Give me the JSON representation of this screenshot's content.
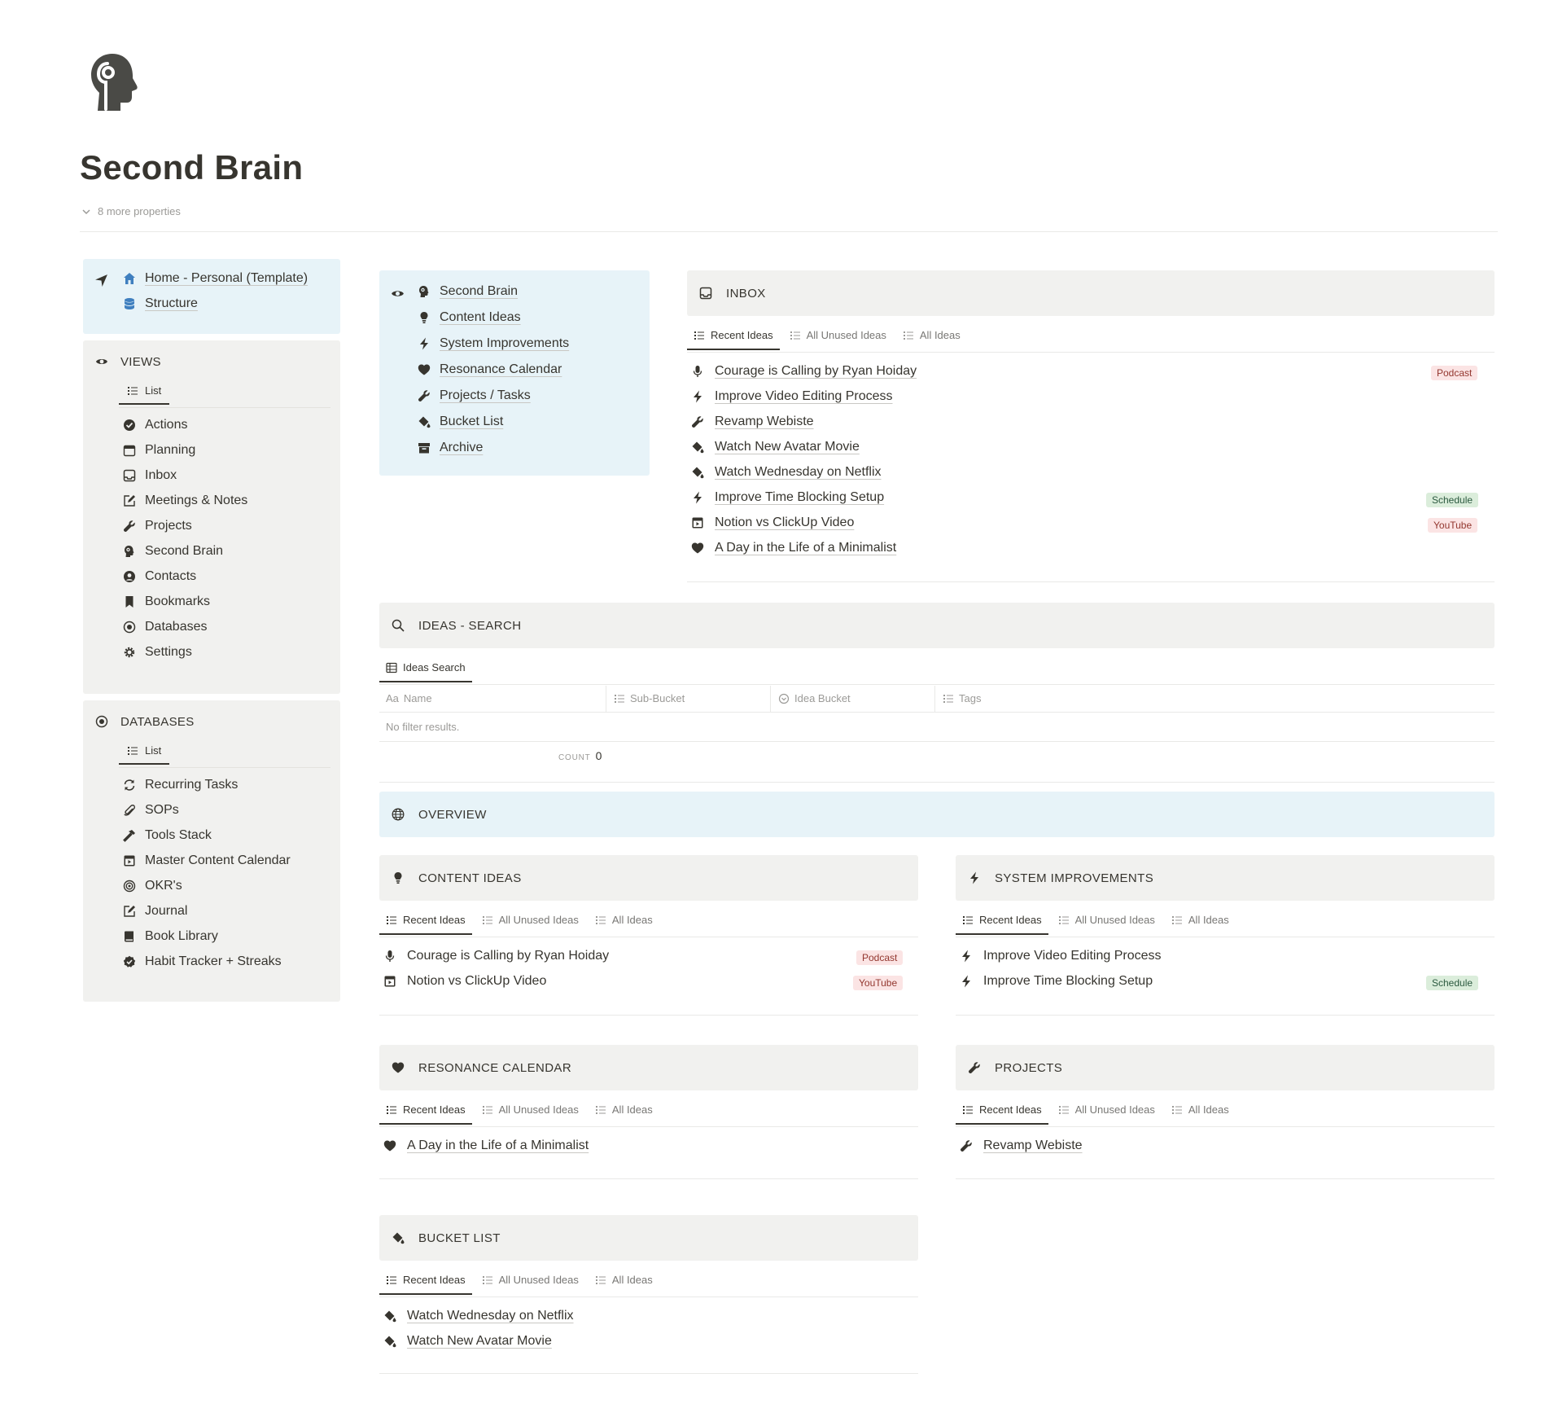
{
  "page": {
    "title": "Second Brain",
    "more_properties": "8 more properties"
  },
  "nav_panel": {
    "items": [
      {
        "label": "Home - Personal (Template)",
        "icon": "house-icon"
      },
      {
        "label": "Structure",
        "icon": "database-stack-icon"
      }
    ]
  },
  "views_panel": {
    "heading": "VIEWS",
    "tab": "List",
    "items": [
      {
        "label": "Actions",
        "icon": "check-circle-icon"
      },
      {
        "label": "Planning",
        "icon": "calendar-icon"
      },
      {
        "label": "Inbox",
        "icon": "inbox-icon"
      },
      {
        "label": "Meetings & Notes",
        "icon": "edit-note-icon"
      },
      {
        "label": "Projects",
        "icon": "wrench-icon"
      },
      {
        "label": "Second Brain",
        "icon": "brain-head-icon"
      },
      {
        "label": "Contacts",
        "icon": "user-circle-icon"
      },
      {
        "label": "Bookmarks",
        "icon": "bookmark-icon"
      },
      {
        "label": "Databases",
        "icon": "target-icon"
      },
      {
        "label": "Settings",
        "icon": "gear-icon"
      }
    ]
  },
  "databases_panel": {
    "heading": "DATABASES",
    "tab": "List",
    "items": [
      {
        "label": "Recurring Tasks",
        "icon": "refresh-icon"
      },
      {
        "label": "SOPs",
        "icon": "paperclip-icon"
      },
      {
        "label": "Tools Stack",
        "icon": "hammer-icon"
      },
      {
        "label": "Master Content Calendar",
        "icon": "film-calendar-icon"
      },
      {
        "label": "OKR's",
        "icon": "bullseye-icon"
      },
      {
        "label": "Journal",
        "icon": "edit-note-icon"
      },
      {
        "label": "Book Library",
        "icon": "book-icon"
      },
      {
        "label": "Habit Tracker + Streaks",
        "icon": "badge-check-icon"
      }
    ]
  },
  "second_brain_nav": {
    "items": [
      {
        "label": "Second Brain",
        "icon": "brain-head-icon"
      },
      {
        "label": "Content Ideas",
        "icon": "lightbulb-icon"
      },
      {
        "label": "System Improvements",
        "icon": "bolt-icon"
      },
      {
        "label": "Resonance Calendar",
        "icon": "heart-icon"
      },
      {
        "label": "Projects / Tasks",
        "icon": "wrench-icon"
      },
      {
        "label": "Bucket List",
        "icon": "paint-bucket-icon"
      },
      {
        "label": "Archive",
        "icon": "archive-box-icon"
      }
    ]
  },
  "tabs_common": {
    "recent": "Recent Ideas",
    "unused": "All Unused Ideas",
    "all": "All Ideas"
  },
  "inbox": {
    "heading": "INBOX",
    "items": [
      {
        "label": "Courage is Calling by Ryan Hoiday",
        "icon": "microphone-icon",
        "tag": "Podcast"
      },
      {
        "label": "Improve Video Editing Process",
        "icon": "bolt-icon"
      },
      {
        "label": "Revamp Webiste",
        "icon": "wrench-icon"
      },
      {
        "label": "Watch New Avatar Movie",
        "icon": "paint-bucket-icon"
      },
      {
        "label": "Watch Wednesday on Netflix",
        "icon": "paint-bucket-icon"
      },
      {
        "label": "Improve Time Blocking Setup",
        "icon": "bolt-icon",
        "tag": "Schedule"
      },
      {
        "label": "Notion vs ClickUp Video",
        "icon": "film-calendar-icon",
        "tag": "YouTube"
      },
      {
        "label": "A Day in the Life of a Minimalist",
        "icon": "heart-icon"
      }
    ]
  },
  "ideas_search": {
    "heading": "IDEAS - SEARCH",
    "tab": "Ideas Search",
    "columns": [
      "Name",
      "Sub-Bucket",
      "Idea Bucket",
      "Tags"
    ],
    "name_prefix": "Aa",
    "empty": "No filter results.",
    "count_label": "COUNT",
    "count_value": "0"
  },
  "overview": {
    "heading": "OVERVIEW"
  },
  "content_ideas": {
    "heading": "CONTENT IDEAS",
    "items": [
      {
        "label": "Courage is Calling by Ryan Hoiday",
        "tag": "Podcast"
      },
      {
        "label": "Notion vs ClickUp Video",
        "tag": "YouTube"
      }
    ]
  },
  "system_improvements": {
    "heading": "SYSTEM IMPROVEMENTS",
    "items": [
      {
        "label": "Improve Video Editing Process"
      },
      {
        "label": "Improve Time Blocking Setup",
        "tag": "Schedule"
      }
    ]
  },
  "resonance_calendar": {
    "heading": "RESONANCE CALENDAR",
    "items": [
      {
        "label": "A Day in the Life of a Minimalist"
      }
    ]
  },
  "projects": {
    "heading": "PROJECTS",
    "items": [
      {
        "label": "Revamp Webiste"
      }
    ]
  },
  "bucket_list": {
    "heading": "BUCKET LIST",
    "items": [
      {
        "label": "Watch Wednesday on Netflix"
      },
      {
        "label": "Watch New Avatar Movie"
      }
    ]
  },
  "colors": {
    "text": "#37352f",
    "muted": "#9b9a97",
    "callout_grey": "#f1f1ef",
    "callout_blue": "#e7f3f8",
    "tag_red_bg": "#fbe4e4",
    "tag_green_bg": "#dbeddb",
    "home_icon_blue": "#3f7fbf"
  }
}
